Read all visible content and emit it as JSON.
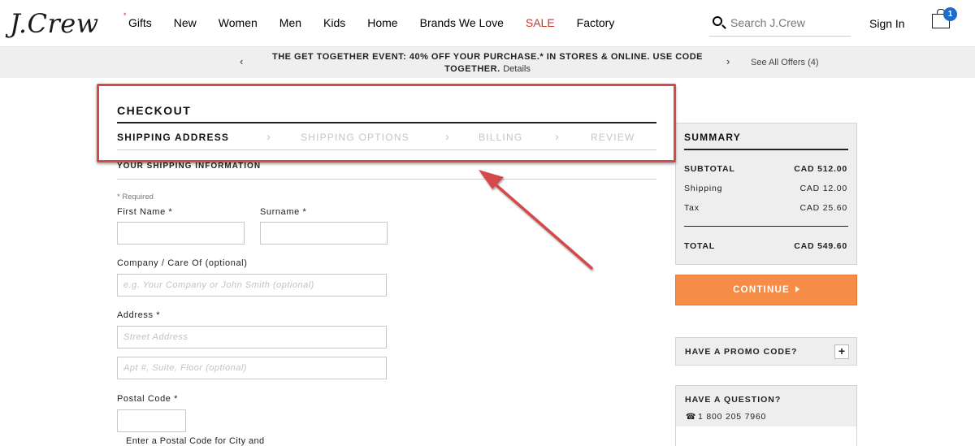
{
  "brand": {
    "logo_text": "J.Crew"
  },
  "nav": {
    "items": [
      {
        "label": "Gifts"
      },
      {
        "label": "New"
      },
      {
        "label": "Women"
      },
      {
        "label": "Men"
      },
      {
        "label": "Kids"
      },
      {
        "label": "Home"
      },
      {
        "label": "Brands We Love"
      },
      {
        "label": "SALE"
      },
      {
        "label": "Factory"
      }
    ],
    "gift_marker": "*"
  },
  "search": {
    "placeholder": "Search J.Crew"
  },
  "account": {
    "sign_in": "Sign In"
  },
  "bag": {
    "count": "1"
  },
  "promo_bar": {
    "prev": "‹",
    "next": "›",
    "message": "THE GET TOGETHER EVENT: 40% OFF YOUR PURCHASE.* IN STORES & ONLINE. USE CODE TOGETHER.",
    "details_link": "Details",
    "see_all": "See All Offers (4)"
  },
  "checkout": {
    "title": "CHECKOUT",
    "steps": [
      "SHIPPING ADDRESS",
      "SHIPPING OPTIONS",
      "BILLING",
      "REVIEW"
    ],
    "separator": "›"
  },
  "shipping_form": {
    "section_title": "YOUR SHIPPING INFORMATION",
    "required_note": "* Required",
    "first_name_label": "First Name *",
    "surname_label": "Surname *",
    "company_label": "Company / Care Of (optional)",
    "company_placeholder": "e.g. Your Company or John Smith (optional)",
    "address_label": "Address *",
    "street_placeholder": "Street Address",
    "apt_placeholder": "Apt #, Suite, Floor (optional)",
    "postal_label": "Postal Code *",
    "postal_helper": "Enter a Postal Code for City and"
  },
  "summary": {
    "title": "SUMMARY",
    "subtotal_label": "SUBTOTAL",
    "subtotal_value": "CAD 512.00",
    "shipping_label": "Shipping",
    "shipping_value": "CAD 12.00",
    "tax_label": "Tax",
    "tax_value": "CAD 25.60",
    "total_label": "TOTAL",
    "total_value": "CAD 549.60"
  },
  "continue_button": {
    "label": "CONTINUE"
  },
  "promo_code": {
    "label": "HAVE A PROMO CODE?",
    "toggle": "+"
  },
  "question": {
    "title": "HAVE A QUESTION?",
    "phone_icon": "☎",
    "phone": "1 800 205 7960"
  },
  "colors": {
    "accent": "#f58c48",
    "sale": "#c9372c",
    "annotation": "#d44a4a",
    "badge": "#1a6dcc"
  }
}
